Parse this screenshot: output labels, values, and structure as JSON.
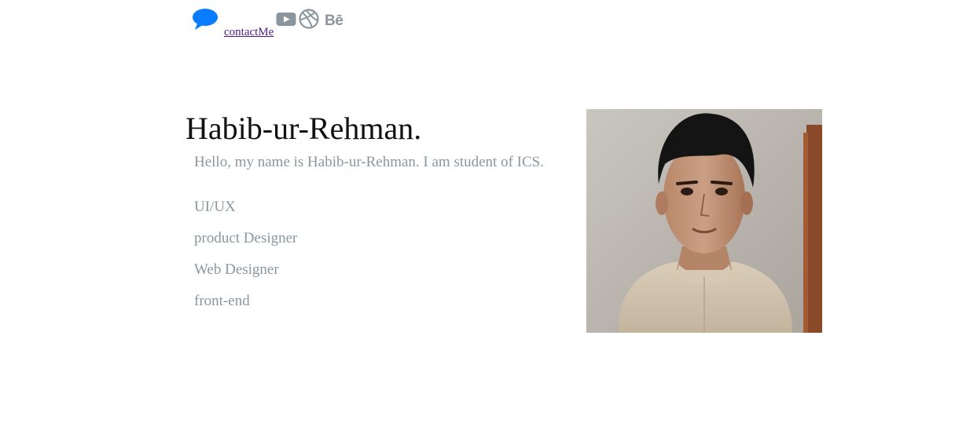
{
  "header": {
    "contact_label": "contactMe",
    "icons": [
      "chat-bubble-icon",
      "youtube-icon",
      "dribbble-icon",
      "behance-icon"
    ],
    "behance_text": "Bē"
  },
  "hero": {
    "name": "Habib-ur-Rehman.",
    "intro": "Hello, my name is Habib-ur-Rehman. I am student of ICS.",
    "roles": [
      "UI/UX",
      "product Designer",
      "Web Designer",
      "front-end"
    ]
  },
  "colors": {
    "chat_icon": "#0a7cff",
    "social_icons": "#8a959d",
    "muted_text": "#8a979f",
    "heading": "#111111",
    "link": "#4b1f8a"
  }
}
